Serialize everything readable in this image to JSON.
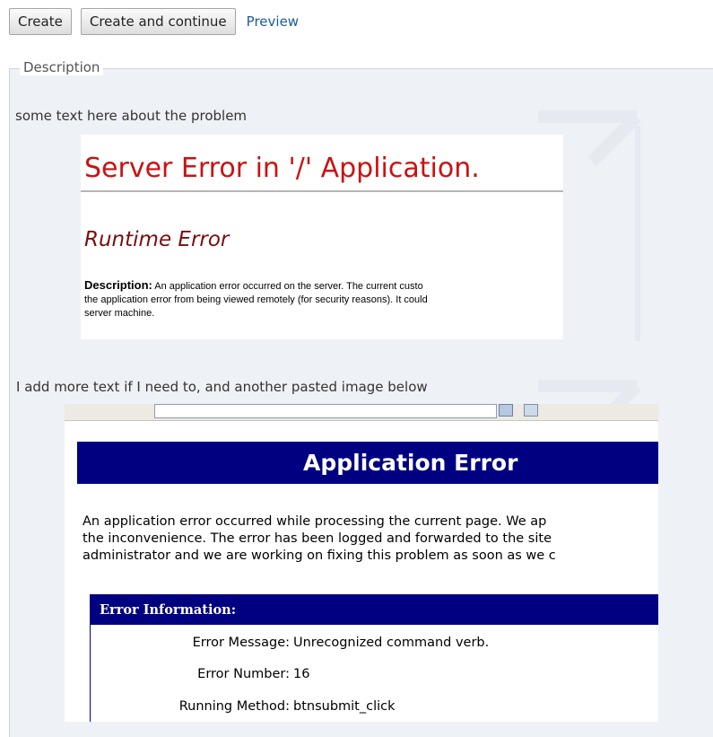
{
  "toolbar": {
    "create_label": "Create",
    "create_continue_label": "Create and continue",
    "preview_label": "Preview"
  },
  "description": {
    "legend": "Description",
    "text1": "some text here about the problem",
    "text2": "I add more text if I need to, and another pasted image below"
  },
  "screenshot1": {
    "title": "Server Error in '/' Application.",
    "subtitle": "Runtime Error",
    "desc_label": "Description:",
    "desc_line1": "An application error occurred on the server. The current custo",
    "desc_line2": "the application error from being viewed remotely (for security reasons). It could",
    "desc_line3": "server machine."
  },
  "screenshot2": {
    "banner": "Application Error",
    "msg_line1": "An application error occurred while processing the current page. We ap",
    "msg_line2": "the inconvenience. The error has been logged and forwarded to the site",
    "msg_line3": "administrator and we are working on fixing this problem as soon as we c",
    "info_header": "Error Information:",
    "rows": [
      {
        "label": "Error Message:",
        "value": "Unrecognized command verb."
      },
      {
        "label": "Error Number:",
        "value": "16"
      },
      {
        "label": "Running Method:",
        "value": "btnsubmit_click"
      }
    ]
  },
  "colors": {
    "link": "#1c5a9c",
    "error_red": "#cc1111",
    "navy": "#000080",
    "panel_bg": "#eef1f6"
  }
}
